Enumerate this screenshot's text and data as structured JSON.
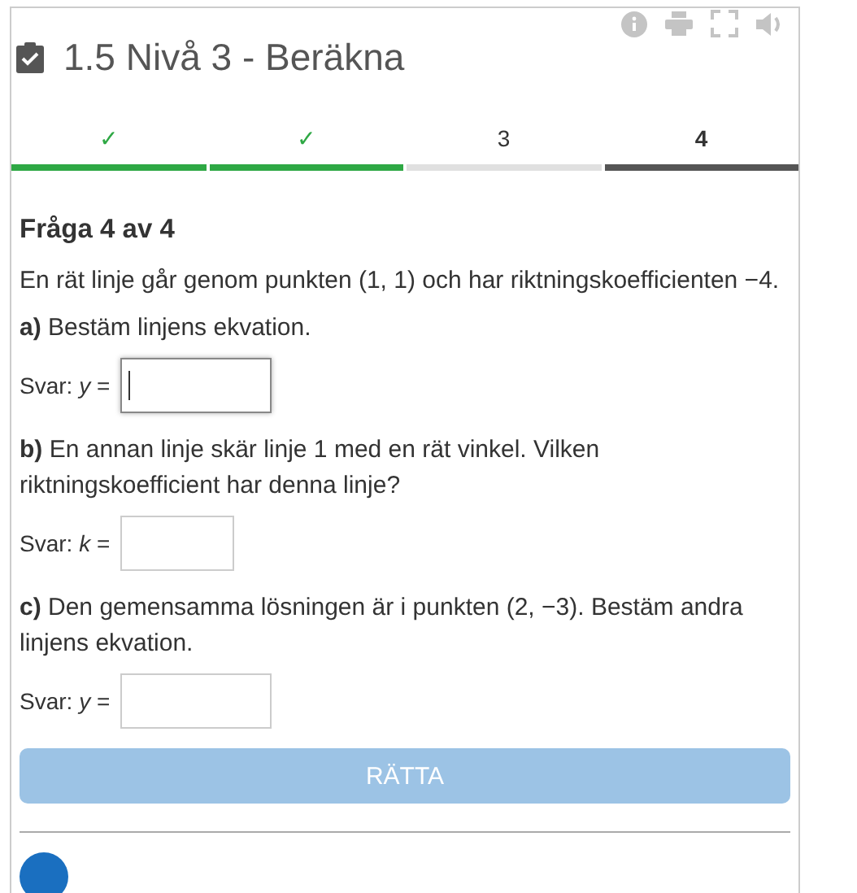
{
  "header": {
    "title": "1.5 Nivå 3 - Beräkna"
  },
  "steps": [
    {
      "label": "✓",
      "done": true,
      "selected": false
    },
    {
      "label": "✓",
      "done": true,
      "selected": false
    },
    {
      "label": "3",
      "done": false,
      "selected": false
    },
    {
      "label": "4",
      "done": false,
      "selected": true
    }
  ],
  "question": {
    "heading": "Fråga 4 av 4",
    "intro": "En rät linje går genom punkten (1, 1) och har riktningskoefficienten −4.",
    "parts": [
      {
        "text": "**a)** Bestäm linjens ekvation.",
        "answer_label": "Svar: *y* =",
        "focused": true
      },
      {
        "text": "**b)** En annan linje skär linje 1 med en rät vinkel. Vilken riktningskoefficient har denna linje?",
        "answer_label": "Svar: *k* =",
        "focused": false
      },
      {
        "text": "**c)** Den gemensamma lösningen är i punkten (2, −3). Bestäm andra linjens ekvation.",
        "answer_label": "Svar: *y* =",
        "focused": false
      }
    ]
  },
  "check_button": {
    "label": "RÄTTA",
    "disabled": true
  }
}
